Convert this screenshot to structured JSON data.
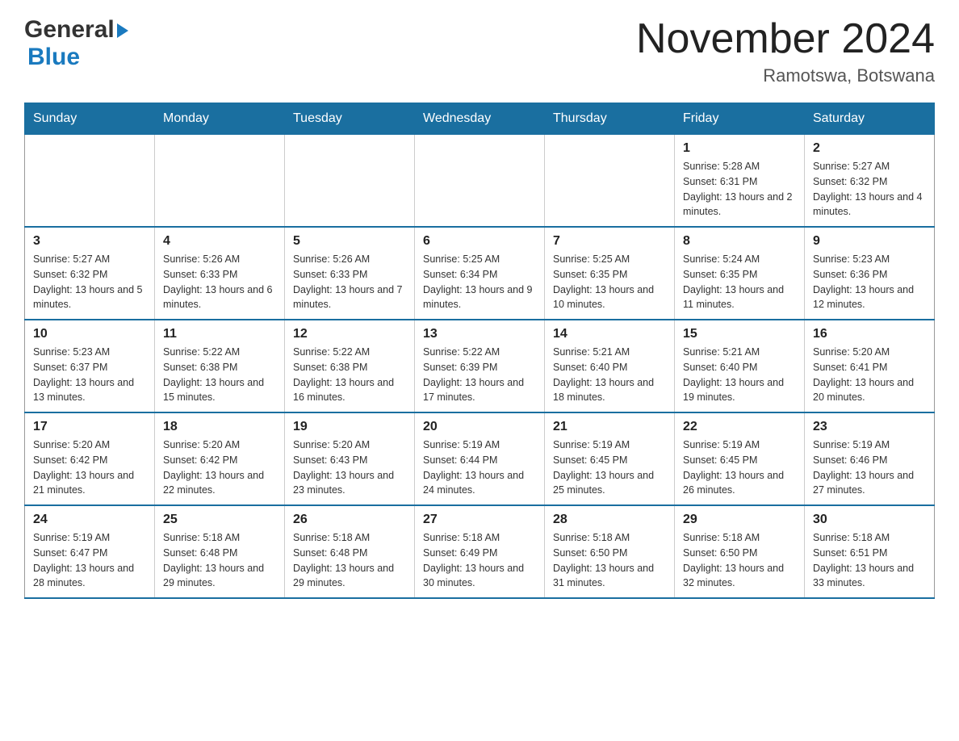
{
  "header": {
    "title": "November 2024",
    "subtitle": "Ramotswa, Botswana",
    "logo_general": "General",
    "logo_blue": "Blue"
  },
  "calendar": {
    "weekdays": [
      "Sunday",
      "Monday",
      "Tuesday",
      "Wednesday",
      "Thursday",
      "Friday",
      "Saturday"
    ],
    "rows": [
      [
        {
          "day": "",
          "info": ""
        },
        {
          "day": "",
          "info": ""
        },
        {
          "day": "",
          "info": ""
        },
        {
          "day": "",
          "info": ""
        },
        {
          "day": "",
          "info": ""
        },
        {
          "day": "1",
          "info": "Sunrise: 5:28 AM\nSunset: 6:31 PM\nDaylight: 13 hours and 2 minutes."
        },
        {
          "day": "2",
          "info": "Sunrise: 5:27 AM\nSunset: 6:32 PM\nDaylight: 13 hours and 4 minutes."
        }
      ],
      [
        {
          "day": "3",
          "info": "Sunrise: 5:27 AM\nSunset: 6:32 PM\nDaylight: 13 hours and 5 minutes."
        },
        {
          "day": "4",
          "info": "Sunrise: 5:26 AM\nSunset: 6:33 PM\nDaylight: 13 hours and 6 minutes."
        },
        {
          "day": "5",
          "info": "Sunrise: 5:26 AM\nSunset: 6:33 PM\nDaylight: 13 hours and 7 minutes."
        },
        {
          "day": "6",
          "info": "Sunrise: 5:25 AM\nSunset: 6:34 PM\nDaylight: 13 hours and 9 minutes."
        },
        {
          "day": "7",
          "info": "Sunrise: 5:25 AM\nSunset: 6:35 PM\nDaylight: 13 hours and 10 minutes."
        },
        {
          "day": "8",
          "info": "Sunrise: 5:24 AM\nSunset: 6:35 PM\nDaylight: 13 hours and 11 minutes."
        },
        {
          "day": "9",
          "info": "Sunrise: 5:23 AM\nSunset: 6:36 PM\nDaylight: 13 hours and 12 minutes."
        }
      ],
      [
        {
          "day": "10",
          "info": "Sunrise: 5:23 AM\nSunset: 6:37 PM\nDaylight: 13 hours and 13 minutes."
        },
        {
          "day": "11",
          "info": "Sunrise: 5:22 AM\nSunset: 6:38 PM\nDaylight: 13 hours and 15 minutes."
        },
        {
          "day": "12",
          "info": "Sunrise: 5:22 AM\nSunset: 6:38 PM\nDaylight: 13 hours and 16 minutes."
        },
        {
          "day": "13",
          "info": "Sunrise: 5:22 AM\nSunset: 6:39 PM\nDaylight: 13 hours and 17 minutes."
        },
        {
          "day": "14",
          "info": "Sunrise: 5:21 AM\nSunset: 6:40 PM\nDaylight: 13 hours and 18 minutes."
        },
        {
          "day": "15",
          "info": "Sunrise: 5:21 AM\nSunset: 6:40 PM\nDaylight: 13 hours and 19 minutes."
        },
        {
          "day": "16",
          "info": "Sunrise: 5:20 AM\nSunset: 6:41 PM\nDaylight: 13 hours and 20 minutes."
        }
      ],
      [
        {
          "day": "17",
          "info": "Sunrise: 5:20 AM\nSunset: 6:42 PM\nDaylight: 13 hours and 21 minutes."
        },
        {
          "day": "18",
          "info": "Sunrise: 5:20 AM\nSunset: 6:42 PM\nDaylight: 13 hours and 22 minutes."
        },
        {
          "day": "19",
          "info": "Sunrise: 5:20 AM\nSunset: 6:43 PM\nDaylight: 13 hours and 23 minutes."
        },
        {
          "day": "20",
          "info": "Sunrise: 5:19 AM\nSunset: 6:44 PM\nDaylight: 13 hours and 24 minutes."
        },
        {
          "day": "21",
          "info": "Sunrise: 5:19 AM\nSunset: 6:45 PM\nDaylight: 13 hours and 25 minutes."
        },
        {
          "day": "22",
          "info": "Sunrise: 5:19 AM\nSunset: 6:45 PM\nDaylight: 13 hours and 26 minutes."
        },
        {
          "day": "23",
          "info": "Sunrise: 5:19 AM\nSunset: 6:46 PM\nDaylight: 13 hours and 27 minutes."
        }
      ],
      [
        {
          "day": "24",
          "info": "Sunrise: 5:19 AM\nSunset: 6:47 PM\nDaylight: 13 hours and 28 minutes."
        },
        {
          "day": "25",
          "info": "Sunrise: 5:18 AM\nSunset: 6:48 PM\nDaylight: 13 hours and 29 minutes."
        },
        {
          "day": "26",
          "info": "Sunrise: 5:18 AM\nSunset: 6:48 PM\nDaylight: 13 hours and 29 minutes."
        },
        {
          "day": "27",
          "info": "Sunrise: 5:18 AM\nSunset: 6:49 PM\nDaylight: 13 hours and 30 minutes."
        },
        {
          "day": "28",
          "info": "Sunrise: 5:18 AM\nSunset: 6:50 PM\nDaylight: 13 hours and 31 minutes."
        },
        {
          "day": "29",
          "info": "Sunrise: 5:18 AM\nSunset: 6:50 PM\nDaylight: 13 hours and 32 minutes."
        },
        {
          "day": "30",
          "info": "Sunrise: 5:18 AM\nSunset: 6:51 PM\nDaylight: 13 hours and 33 minutes."
        }
      ]
    ]
  }
}
